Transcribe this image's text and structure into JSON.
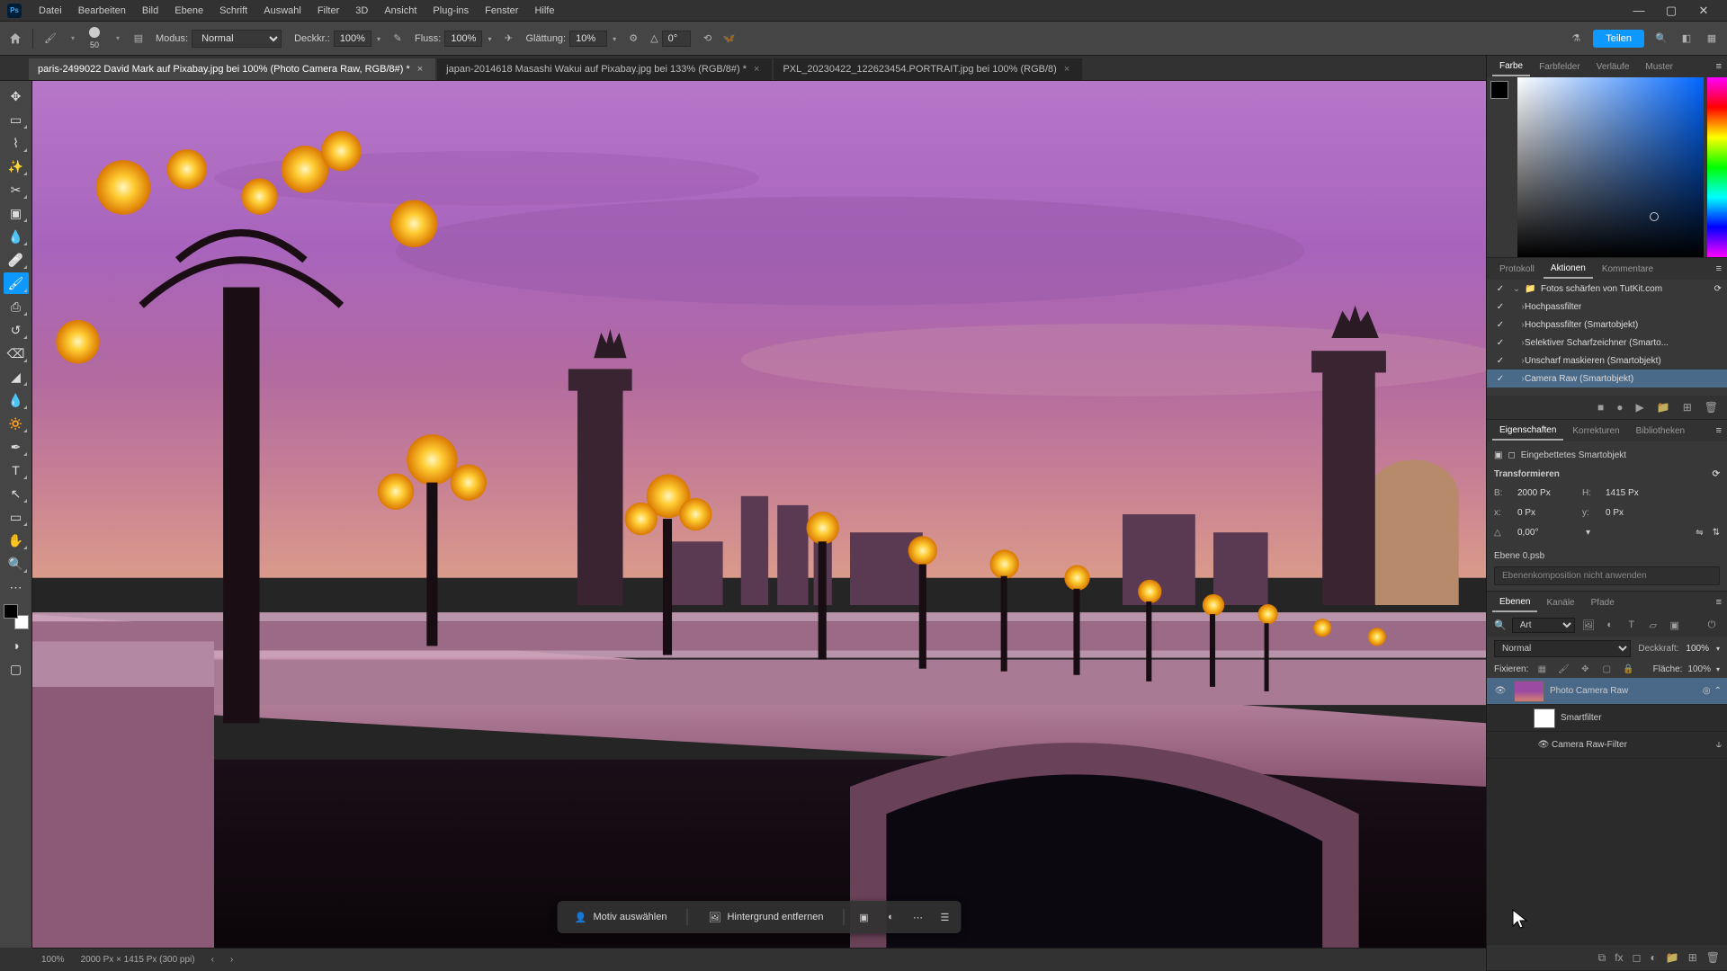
{
  "menubar": {
    "items": [
      "Datei",
      "Bearbeiten",
      "Bild",
      "Ebene",
      "Schrift",
      "Auswahl",
      "Filter",
      "3D",
      "Ansicht",
      "Plug-ins",
      "Fenster",
      "Hilfe"
    ]
  },
  "optbar": {
    "brush_size": "50",
    "mode_label": "Modus:",
    "mode_value": "Normal",
    "opacity_label": "Deckkr.:",
    "opacity_value": "100%",
    "flow_label": "Fluss:",
    "flow_value": "100%",
    "smoothing_label": "Glättung:",
    "smoothing_value": "10%",
    "angle_value": "0°",
    "share": "Teilen"
  },
  "tabs": [
    {
      "label": "paris-2499022  David Mark auf Pixabay.jpg bei 100% (Photo Camera Raw, RGB/8#) *",
      "active": true
    },
    {
      "label": "japan-2014618 Masashi Wakui auf Pixabay.jpg bei 133% (RGB/8#) *",
      "active": false
    },
    {
      "label": "PXL_20230422_122623454.PORTRAIT.jpg bei 100% (RGB/8)",
      "active": false
    }
  ],
  "panels": {
    "color": {
      "tabs": [
        "Farbe",
        "Farbfelder",
        "Verläufe",
        "Muster"
      ],
      "active": 0
    },
    "actions": {
      "tabs": [
        "Protokoll",
        "Aktionen",
        "Kommentare"
      ],
      "active": 1,
      "set": "Fotos schärfen von TutKit.com",
      "items": [
        {
          "label": "Hochpassfilter"
        },
        {
          "label": "Hochpassfilter (Smartobjekt)"
        },
        {
          "label": "Selektiver Scharfzeichner (Smarto..."
        },
        {
          "label": "Unscharf maskieren (Smartobjekt)"
        },
        {
          "label": "Camera Raw (Smartobjekt)",
          "selected": true
        }
      ]
    },
    "properties": {
      "tabs": [
        "Eigenschaften",
        "Korrekturen",
        "Bibliotheken"
      ],
      "active": 0,
      "so_label": "Eingebettetes Smartobjekt",
      "transform_label": "Transformieren",
      "w_label": "B:",
      "w": "2000 Px",
      "h_label": "H:",
      "h": "1415 Px",
      "x_label": "x:",
      "x": "0 Px",
      "y_label": "y:",
      "y": "0 Px",
      "angle_label": "△",
      "angle": "0,00°",
      "layer0": "Ebene 0.psb",
      "embed_note": "Ebenenkomposition nicht anwenden"
    },
    "layers": {
      "tabs": [
        "Ebenen",
        "Kanäle",
        "Pfade"
      ],
      "active": 0,
      "search": "Art",
      "blend": "Normal",
      "opacity_label": "Deckkraft:",
      "opacity": "100%",
      "lock_label": "Fixieren:",
      "fill_label": "Fläche:",
      "fill": "100%",
      "items": [
        {
          "name": "Photo Camera Raw",
          "selected": true
        },
        {
          "name": "Smartfilter",
          "sub": true
        },
        {
          "name": "Camera Raw-Filter",
          "sub": true,
          "deeper": true
        }
      ]
    }
  },
  "canvas_toolbar": {
    "subject": "Motiv auswählen",
    "removebg": "Hintergrund entfernen"
  },
  "status": {
    "zoom": "100%",
    "docsize": "2000 Px × 1415 Px (300 ppi)"
  }
}
